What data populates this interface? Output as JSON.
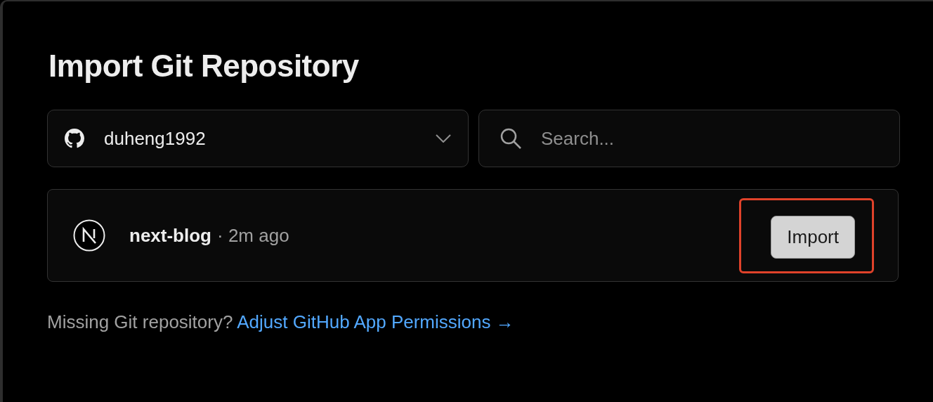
{
  "title": "Import Git Repository",
  "account": {
    "name": "duheng1992"
  },
  "search": {
    "placeholder": "Search..."
  },
  "repositories": [
    {
      "name": "next-blog",
      "meta": "· 2m ago",
      "button": "Import",
      "highlighted": true
    }
  ],
  "footer": {
    "text": "Missing Git repository?",
    "link": "Adjust GitHub App Permissions →"
  }
}
